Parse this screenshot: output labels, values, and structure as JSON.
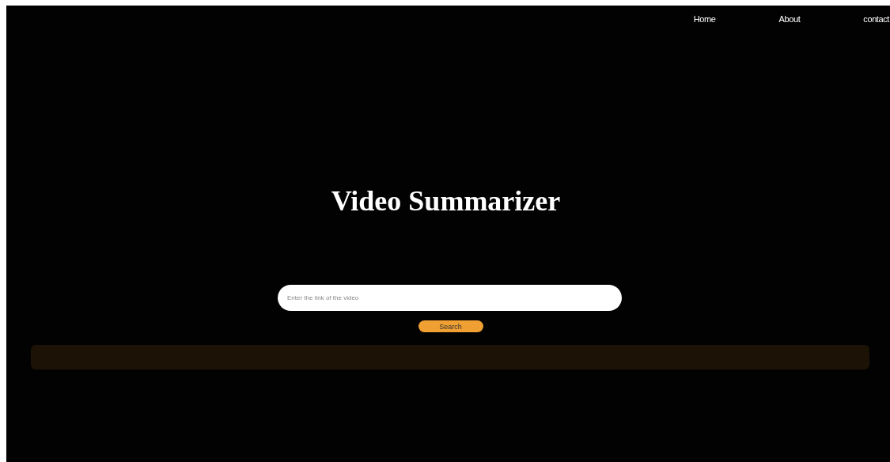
{
  "nav": {
    "links": [
      "Home",
      "About",
      "contact"
    ]
  },
  "title": "Video Summarizer",
  "search": {
    "placeholder": "Enter the link of the video",
    "button": "Search"
  },
  "summary": {
    "kind": "empty-panel"
  }
}
